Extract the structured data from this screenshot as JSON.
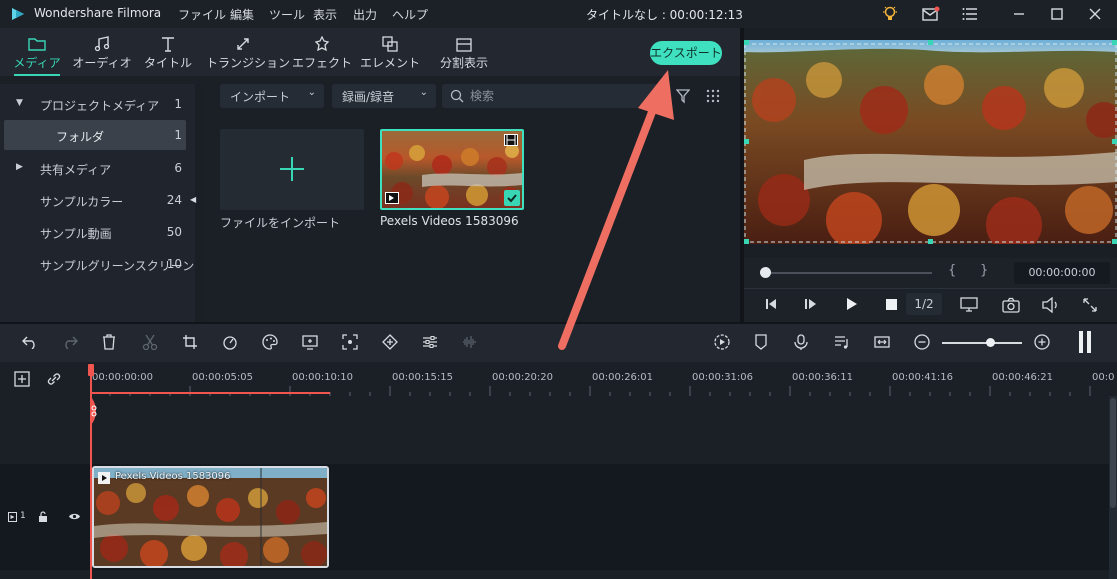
{
  "app": {
    "title": "Wondershare Filmora",
    "document_title": "タイトルなし : 00:00:12:13"
  },
  "menu": [
    "ファイル",
    "編集",
    "ツール",
    "表示",
    "出力",
    "ヘルプ"
  ],
  "tabs": [
    {
      "label": "メディア",
      "icon": "folder-icon",
      "active": true
    },
    {
      "label": "オーディオ",
      "icon": "music-icon"
    },
    {
      "label": "タイトル",
      "icon": "text-icon"
    },
    {
      "label": "トランジション",
      "icon": "transition-icon"
    },
    {
      "label": "エフェクト",
      "icon": "effect-icon"
    },
    {
      "label": "エレメント",
      "icon": "element-icon"
    },
    {
      "label": "分割表示",
      "icon": "split-screen-icon"
    }
  ],
  "export_label": "エクスポート",
  "sidebar": {
    "items": [
      {
        "label": "プロジェクトメディア",
        "count": "1"
      },
      {
        "label": "フォルダ",
        "count": "1"
      },
      {
        "label": "共有メディア",
        "count": "6"
      },
      {
        "label": "サンプルカラー",
        "count": "24"
      },
      {
        "label": "サンプル動画",
        "count": "50"
      },
      {
        "label": "サンプルグリーンスクリーン",
        "count": "10"
      }
    ]
  },
  "media": {
    "import_dropdown": "インポート",
    "record_dropdown": "録画/録音",
    "search_placeholder": "検索",
    "import_tile_label": "ファイルをインポート",
    "clip_name": "Pexels Videos 1583096"
  },
  "preview": {
    "timecode": "00:00:00:00",
    "ratio": "1/2"
  },
  "timeline": {
    "ticks": [
      "00:00:00:00",
      "00:00:05:05",
      "00:00:10:10",
      "00:00:15:15",
      "00:00:20:20",
      "00:00:26:01",
      "00:00:31:06",
      "00:00:36:11",
      "00:00:41:16",
      "00:00:46:21",
      "00:0"
    ],
    "clip_name": "Pexels Videos 1583096",
    "track_label": "1"
  },
  "colors": {
    "accent": "#3ee0bf",
    "playhead": "#f0564f",
    "arrow": "#ee6f62"
  }
}
